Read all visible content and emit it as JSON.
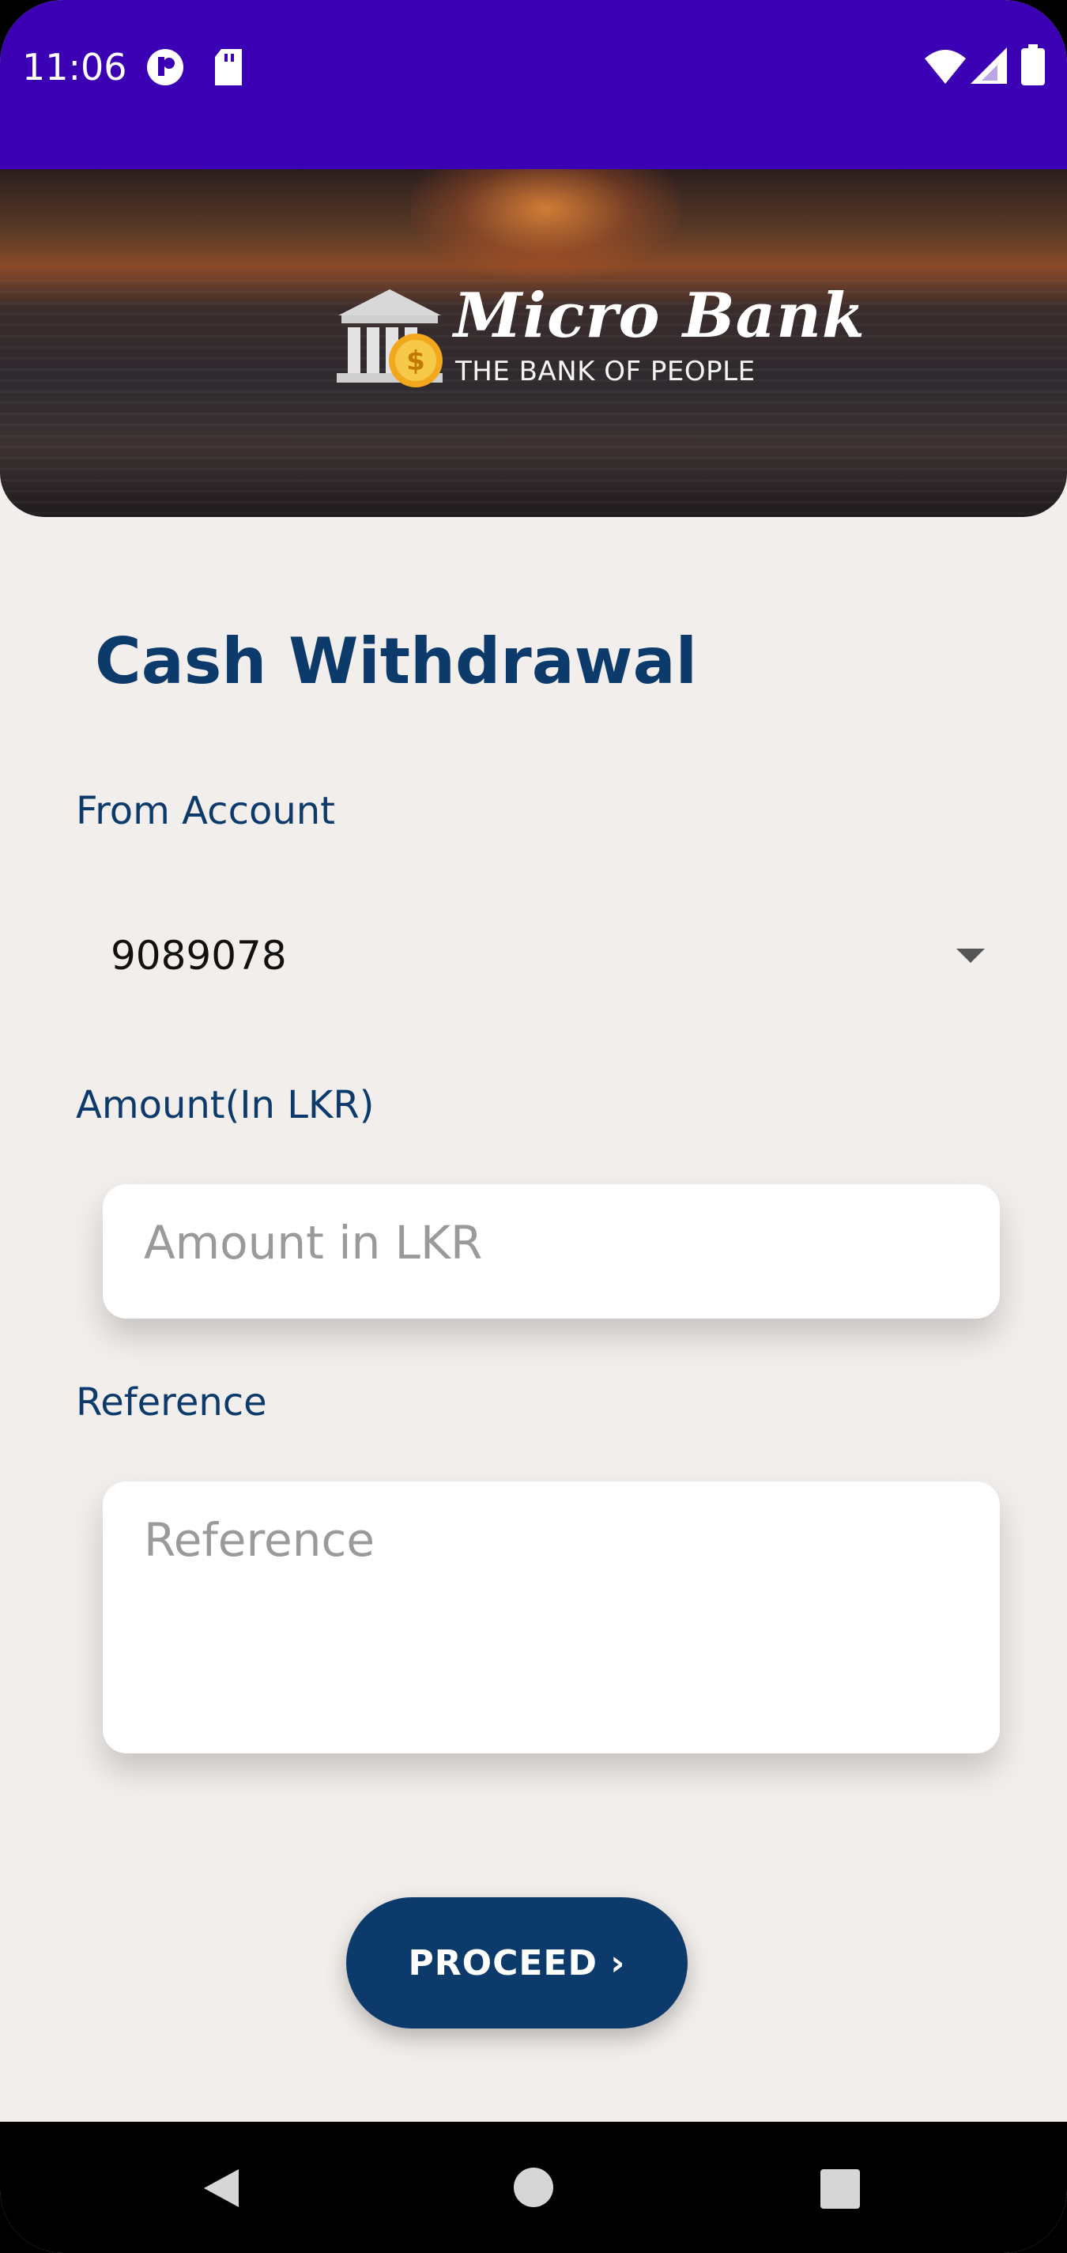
{
  "status_bar": {
    "time": "11:06",
    "background_color": "#3c00b4",
    "left_icons": [
      "notification-app-icon",
      "sd-card-icon"
    ],
    "right_icons": [
      "wifi-icon",
      "cell-signal-icon",
      "battery-icon"
    ]
  },
  "banner": {
    "brand_name": "Micro Bank",
    "tagline": "THE BANK OF PEOPLE",
    "logo_icon": "bank-building-coin-icon"
  },
  "page": {
    "title": "Cash Withdrawal"
  },
  "form": {
    "from_account": {
      "label": "From Account",
      "selected_value": "9089078"
    },
    "amount": {
      "label": "Amount(In LKR)",
      "placeholder": "Amount in LKR",
      "value": ""
    },
    "reference": {
      "label": "Reference",
      "placeholder": "Reference",
      "value": ""
    },
    "proceed_label": "PROCEED ›"
  },
  "navigation": {
    "buttons": [
      "back-icon",
      "home-icon",
      "recents-icon"
    ]
  },
  "colors": {
    "primary": "#0c3b6b",
    "background": "#f2eeec",
    "status_bar": "#3c00b4"
  }
}
